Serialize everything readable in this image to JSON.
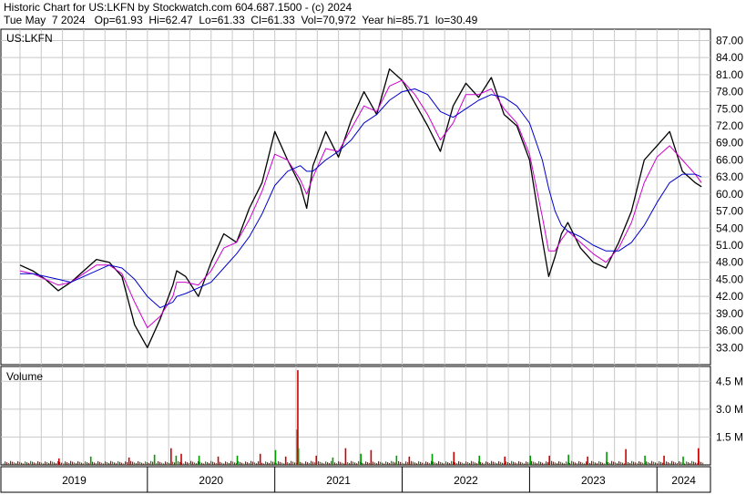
{
  "header": {
    "line1": "Historic Chart for US:LKFN by Stockwatch.com 604.687.1500 - (c) 2024",
    "line2": "Tue May  7 2024   Op=61.93  Hi=62.47  Lo=61.33  Cl=61.33  Vol=70,972  Year hi=85.71  lo=30.49"
  },
  "chart_data": [
    {
      "type": "line",
      "title": "US:LKFN",
      "y_ticks": [
        "87.00",
        "84.00",
        "81.00",
        "78.00",
        "75.00",
        "72.00",
        "69.00",
        "66.00",
        "63.00",
        "60.00",
        "57.00",
        "54.00",
        "51.00",
        "48.00",
        "45.00",
        "42.00",
        "39.00",
        "36.00",
        "33.00"
      ],
      "ylim": [
        30.0,
        89.0
      ],
      "x": [
        2019.0,
        2019.1,
        2019.2,
        2019.3,
        2019.4,
        2019.5,
        2019.6,
        2019.7,
        2019.8,
        2019.9,
        2020.0,
        2020.1,
        2020.2,
        2020.23,
        2020.3,
        2020.4,
        2020.5,
        2020.6,
        2020.7,
        2020.8,
        2020.9,
        2021.0,
        2021.1,
        2021.2,
        2021.25,
        2021.3,
        2021.4,
        2021.5,
        2021.6,
        2021.7,
        2021.8,
        2021.9,
        2022.0,
        2022.1,
        2022.2,
        2022.3,
        2022.4,
        2022.5,
        2022.6,
        2022.7,
        2022.8,
        2022.9,
        2023.0,
        2023.1,
        2023.15,
        2023.2,
        2023.25,
        2023.3,
        2023.4,
        2023.5,
        2023.6,
        2023.7,
        2023.8,
        2023.9,
        2024.0,
        2024.1,
        2024.2,
        2024.3,
        2024.35
      ],
      "series": [
        {
          "name": "",
          "color": "#000000",
          "values": [
            47.5,
            46.5,
            45.0,
            43.0,
            44.5,
            46.5,
            48.5,
            48.0,
            45.5,
            37.0,
            33.0,
            38.0,
            44.0,
            46.5,
            45.5,
            42.0,
            48.0,
            53.0,
            51.5,
            57.5,
            62.0,
            71.0,
            66.0,
            61.5,
            57.5,
            65.0,
            71.0,
            66.5,
            73.0,
            78.0,
            74.0,
            82.0,
            80.0,
            76.0,
            72.0,
            67.5,
            75.5,
            79.5,
            77.0,
            80.5,
            74.0,
            72.0,
            66.0,
            52.0,
            45.5,
            49.0,
            53.0,
            55.0,
            50.5,
            48.0,
            47.0,
            51.5,
            57.0,
            66.0,
            68.5,
            71.0,
            64.0,
            62.0,
            61.3
          ]
        },
        {
          "name": "",
          "color": "#cc00cc",
          "values": [
            46.5,
            46.0,
            45.0,
            44.0,
            44.5,
            46.0,
            47.5,
            47.5,
            46.0,
            41.0,
            36.5,
            38.5,
            42.0,
            44.5,
            44.5,
            44.0,
            46.5,
            50.5,
            51.5,
            55.5,
            60.5,
            67.0,
            66.0,
            62.5,
            60.0,
            63.0,
            68.0,
            67.5,
            71.5,
            75.5,
            74.5,
            79.0,
            80.0,
            77.5,
            74.0,
            69.5,
            72.5,
            77.5,
            77.5,
            78.5,
            75.0,
            72.5,
            67.0,
            56.0,
            50.0,
            50.0,
            52.0,
            53.5,
            51.5,
            49.5,
            48.0,
            50.5,
            55.0,
            62.0,
            66.5,
            68.5,
            66.0,
            63.5,
            62.0
          ]
        },
        {
          "name": "",
          "color": "#0000cc",
          "values": [
            46.0,
            46.0,
            45.5,
            45.0,
            44.5,
            45.5,
            46.5,
            47.5,
            47.0,
            45.0,
            42.0,
            40.0,
            41.0,
            42.0,
            42.5,
            43.5,
            44.5,
            47.0,
            49.5,
            52.5,
            56.5,
            61.5,
            64.0,
            65.0,
            64.0,
            64.0,
            66.0,
            67.5,
            69.5,
            72.5,
            74.0,
            76.5,
            78.0,
            78.5,
            77.5,
            74.5,
            73.5,
            75.0,
            76.5,
            77.5,
            77.0,
            75.5,
            72.5,
            66.0,
            61.0,
            57.0,
            54.5,
            53.5,
            52.5,
            51.0,
            50.0,
            50.0,
            51.5,
            54.5,
            58.5,
            62.0,
            63.5,
            63.5,
            63.0
          ]
        }
      ]
    },
    {
      "type": "bar",
      "title": "Volume",
      "y_ticks": [
        "4.5 M",
        "3.0 M",
        "1.5 M"
      ],
      "ylim": [
        0,
        5.3
      ],
      "x": [
        2019.3,
        2019.55,
        2019.85,
        2020.05,
        2020.18,
        2020.22,
        2020.26,
        2020.4,
        2020.55,
        2020.7,
        2020.88,
        2021.0,
        2021.08,
        2021.17,
        2021.175,
        2021.18,
        2021.32,
        2021.45,
        2021.55,
        2021.67,
        2021.75,
        2021.95,
        2022.05,
        2022.23,
        2022.4,
        2022.6,
        2022.8,
        2023.0,
        2023.15,
        2023.3,
        2023.45,
        2023.6,
        2023.75,
        2023.9,
        2024.05,
        2024.2,
        2024.32
      ],
      "values": [
        0.35,
        0.45,
        0.4,
        0.55,
        0.9,
        0.5,
        0.6,
        0.5,
        0.45,
        0.5,
        0.6,
        0.8,
        0.45,
        1.9,
        5.1,
        0.9,
        0.5,
        0.4,
        0.9,
        0.6,
        0.8,
        0.5,
        0.45,
        0.6,
        0.7,
        0.5,
        0.45,
        0.5,
        0.5,
        0.55,
        0.45,
        0.7,
        0.85,
        0.5,
        0.5,
        0.45,
        0.9
      ]
    }
  ],
  "x_axis": {
    "labels": [
      "2019",
      "2020",
      "2021",
      "2022",
      "2023",
      "2024"
    ],
    "year_starts": [
      2019.0,
      2020.0,
      2021.0,
      2022.0,
      2023.0,
      2024.0
    ],
    "xlim": [
      2018.85,
      2024.42
    ]
  }
}
